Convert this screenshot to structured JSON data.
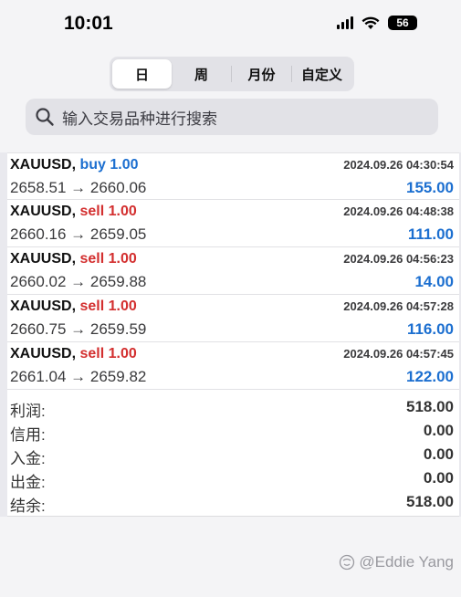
{
  "status_bar": {
    "time": "10:01",
    "battery": "56"
  },
  "tabs": [
    {
      "label": "日",
      "active": true
    },
    {
      "label": "周",
      "active": false
    },
    {
      "label": "月份",
      "active": false
    },
    {
      "label": "自定义",
      "active": false
    }
  ],
  "search": {
    "placeholder": "输入交易品种进行搜索"
  },
  "trades": [
    {
      "symbol": "XAUUSD,",
      "side": "buy",
      "volume": "buy 1.00",
      "datetime": "2024.09.26 04:30:54",
      "prices": "2658.51 → 2660.06",
      "profit": "155.00"
    },
    {
      "symbol": "XAUUSD,",
      "side": "sell",
      "volume": "sell 1.00",
      "datetime": "2024.09.26 04:48:38",
      "prices": "2660.16 → 2659.05",
      "profit": "111.00"
    },
    {
      "symbol": "XAUUSD,",
      "side": "sell",
      "volume": "sell 1.00",
      "datetime": "2024.09.26 04:56:23",
      "prices": "2660.02 → 2659.88",
      "profit": "14.00"
    },
    {
      "symbol": "XAUUSD,",
      "side": "sell",
      "volume": "sell 1.00",
      "datetime": "2024.09.26 04:57:28",
      "prices": "2660.75 → 2659.59",
      "profit": "116.00"
    },
    {
      "symbol": "XAUUSD,",
      "side": "sell",
      "volume": "sell 1.00",
      "datetime": "2024.09.26 04:57:45",
      "prices": "2661.04 → 2659.82",
      "profit": "122.00"
    }
  ],
  "summary": [
    {
      "label": "利润:",
      "value": "518.00"
    },
    {
      "label": "信用:",
      "value": "0.00"
    },
    {
      "label": "入金:",
      "value": "0.00"
    },
    {
      "label": "出金:",
      "value": "0.00"
    },
    {
      "label": "结余:",
      "value": "518.00"
    }
  ],
  "watermark": "@Eddie Yang",
  "colors": {
    "buy": "#1c6fd0",
    "sell": "#d32f2f",
    "profit": "#1c6fd0"
  }
}
